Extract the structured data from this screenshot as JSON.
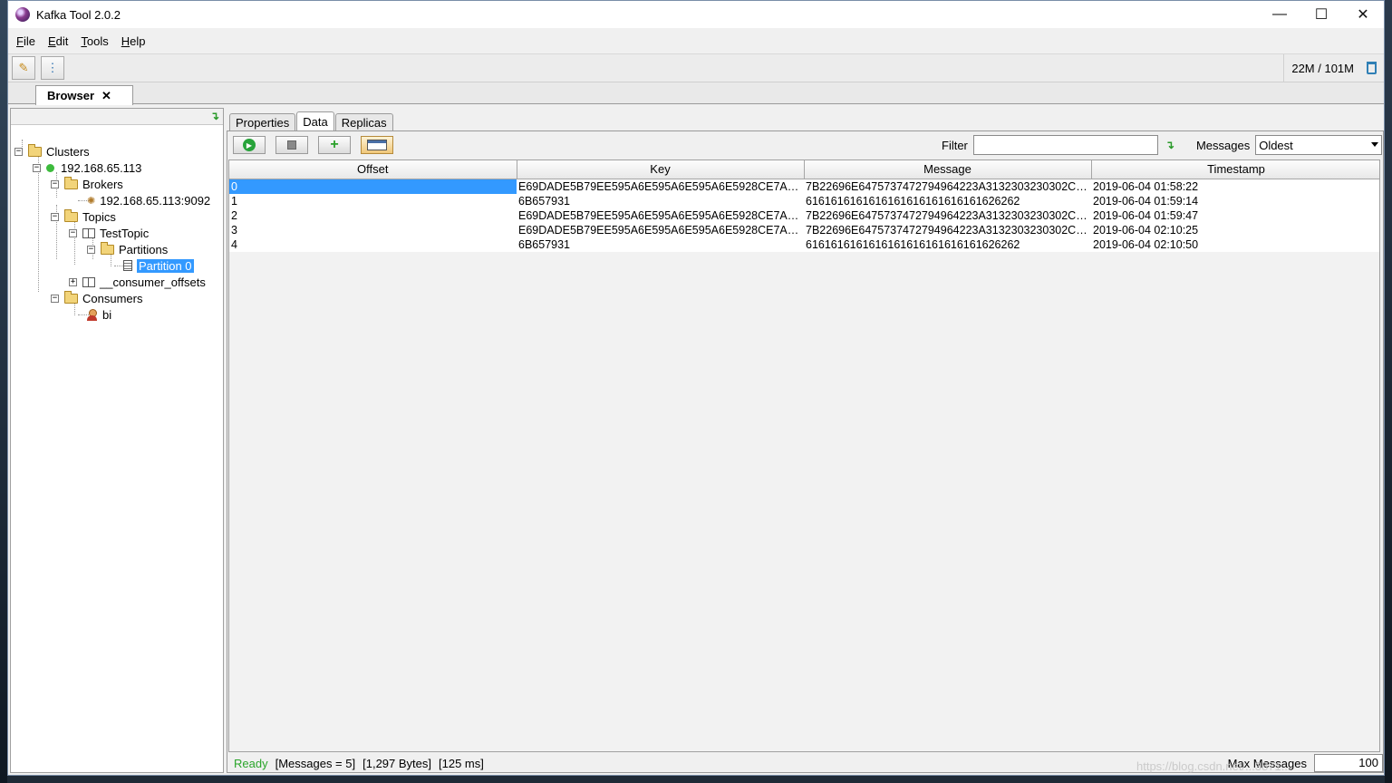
{
  "window": {
    "title": "Kafka Tool  2.0.2"
  },
  "window_controls": {
    "minimize": "—",
    "maximize": "☐",
    "close": "✕"
  },
  "menu": [
    {
      "mnemonic": "F",
      "rest": "ile"
    },
    {
      "mnemonic": "E",
      "rest": "dit"
    },
    {
      "mnemonic": "T",
      "rest": "ools"
    },
    {
      "mnemonic": "H",
      "rest": "elp"
    }
  ],
  "toolbar": {
    "memory": "22M / 101M"
  },
  "doc_tab": {
    "label": "Browser",
    "close": "✕"
  },
  "tree": {
    "clusters": "Clusters",
    "cluster_host": "192.168.65.113",
    "brokers": "Brokers",
    "broker": "192.168.65.113:9092",
    "topics": "Topics",
    "topic": "TestTopic",
    "partitions": "Partitions",
    "partition": "Partition 0",
    "consumer_offsets": "__consumer_offsets",
    "consumers": "Consumers",
    "consumer": "bi"
  },
  "subtabs": [
    "Properties",
    "Data",
    "Replicas"
  ],
  "active_subtab": "Data",
  "filter": {
    "label": "Filter",
    "value": ""
  },
  "messages_select": {
    "label": "Messages",
    "value": "Oldest"
  },
  "table": {
    "columns": [
      "Offset",
      "Key",
      "Message",
      "Timestamp"
    ],
    "rows": [
      [
        "0",
        "E69DADE5B79EE595A6E595A6E595A6E5928CE7A79...",
        "7B22696E6475737472794964223A3132303230302C2...",
        "2019-06-04 01:58:22"
      ],
      [
        "1",
        "6B657931",
        "6161616161616161616161616161626262",
        "2019-06-04 01:59:14"
      ],
      [
        "2",
        "E69DADE5B79EE595A6E595A6E595A6E5928CE7A79...",
        "7B22696E6475737472794964223A3132303230302C2...",
        "2019-06-04 01:59:47"
      ],
      [
        "3",
        "E69DADE5B79EE595A6E595A6E595A6E5928CE7A79...",
        "7B22696E6475737472794964223A3132303230302C2...",
        "2019-06-04 02:10:25"
      ],
      [
        "4",
        "6B657931",
        "6161616161616161616161616161626262",
        "2019-06-04 02:10:50"
      ]
    ]
  },
  "status": {
    "ready": "Ready",
    "messages": "[Messages = 5]",
    "bytes": "[1,297 Bytes]",
    "time": "[125 ms]",
    "max_messages_label": "Max Messages",
    "max_messages_value": "100"
  },
  "watermark": "https://blog.csdn.net/...3871...",
  "colors": {
    "selection": "#3399ff",
    "ready": "#2aa52a"
  }
}
